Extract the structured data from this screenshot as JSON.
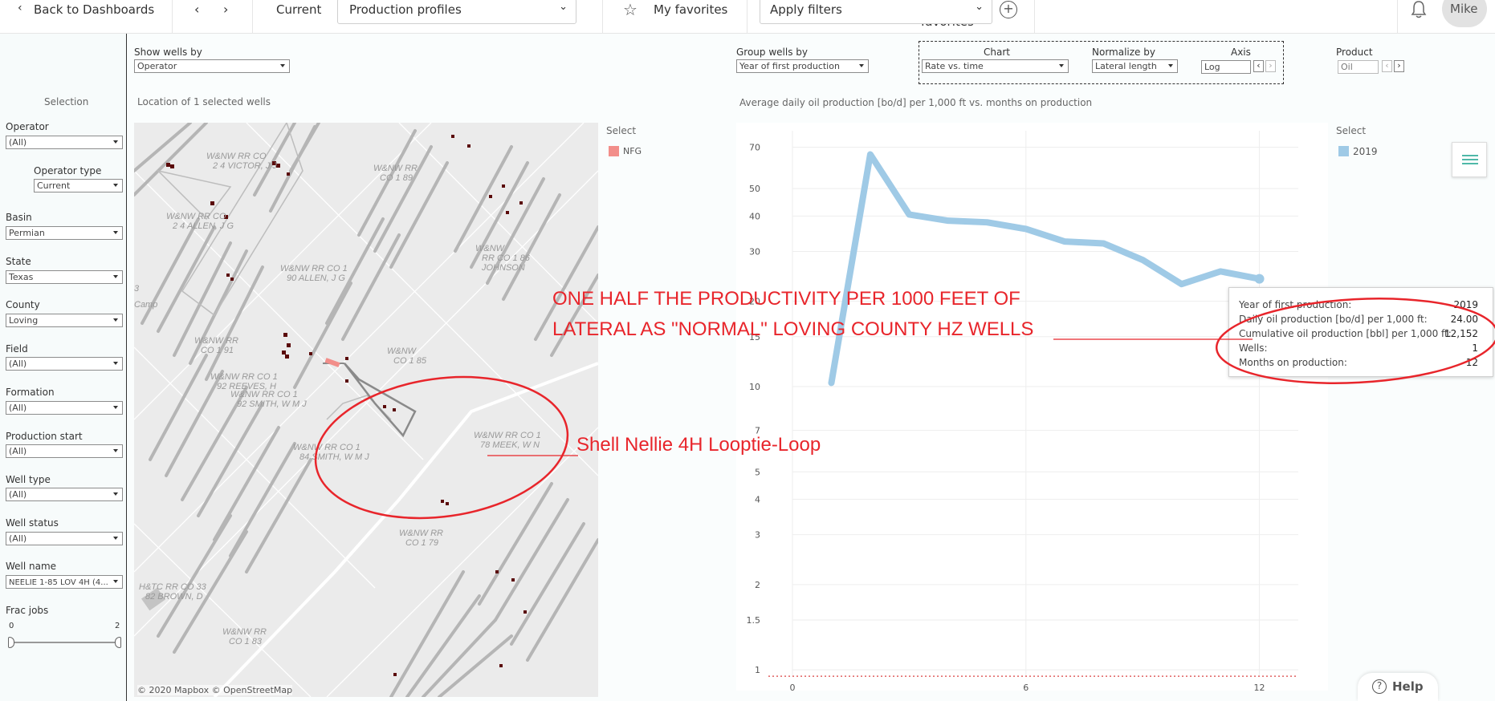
{
  "topbar": {
    "back_label": "Back to Dashboards",
    "current_label": "Current",
    "current_value": "Production profiles",
    "favorites_label": "My favorites",
    "filters_placeholder": "Apply filters",
    "user_name": "Mike"
  },
  "left_panel": {
    "title": "Selection",
    "filters": [
      {
        "label": "Operator",
        "value": "(All)"
      },
      {
        "label": "Operator type",
        "value": "Current"
      },
      {
        "label": "Basin",
        "value": "Permian"
      },
      {
        "label": "State",
        "value": "Texas"
      },
      {
        "label": "County",
        "value": "Loving"
      },
      {
        "label": "Field",
        "value": "(All)"
      },
      {
        "label": "Formation",
        "value": "(All)"
      },
      {
        "label": "Production start",
        "value": "(All)"
      },
      {
        "label": "Well type",
        "value": "(All)"
      },
      {
        "label": "Well status",
        "value": "(All)"
      },
      {
        "label": "Well name",
        "value": "NEELIE 1-85 LOV 4H (4..."
      }
    ],
    "frac_jobs": {
      "label": "Frac jobs",
      "min": "0",
      "max": "2"
    }
  },
  "controls": {
    "show_wells_by_label": "Show wells by",
    "show_wells_by_value": "Operator",
    "group_wells_by_label": "Group wells by",
    "group_wells_by_value": "Year of first production",
    "chart_label": "Chart",
    "chart_value": "Rate vs. time",
    "normalize_label": "Normalize by",
    "normalize_value": "Lateral length",
    "axis_label": "Axis",
    "axis_value": "Log",
    "product_label": "Product",
    "product_value": "Oil"
  },
  "map": {
    "caption": "Location of 1 selected wells",
    "legend_title": "Select",
    "legend_item": "NFG",
    "legend_color": "#f28e8a",
    "attribution": "© 2020 Mapbox © OpenStreetMap",
    "labels": [
      "W&NW RR CO\n2 4 VICTOR, J J",
      "W&NW RR\nCO 1 89",
      "W&NW RR CO\n2 4 ALLEN, J G",
      "W&NW\nRR CO 1 86\nJOHNSON",
      "W&NW RR CO 1\n90 ALLEN, J G",
      "W&NW RR\nCO 1 91",
      "W&NW RR CO 1\n92 REEVES, H",
      "W&NW RR CO 1\n92 SMITH, W M J",
      "W&NW\nCO 1 85",
      "W&NW RR CO 1\n84 SMITH, W M J",
      "W&NW RR CO 1\n78 MEEK, W N",
      "H&TC RR CO 33\n82 BROWN, D",
      "W&NW RR\nCO 1 79",
      "W&NW RR\nCO 1 83",
      "Camp",
      "3"
    ]
  },
  "chart": {
    "caption": "Average daily oil production [bo/d] per 1,000 ft vs. months on production",
    "legend_title": "Select",
    "legend_item": "2019",
    "series_color": "#9fcae6"
  },
  "chart_data": {
    "type": "line",
    "title": "Average daily oil production [bo/d] per 1,000 ft vs. months on production",
    "xlabel": "",
    "ylabel": "",
    "yscale": "log",
    "xlim": [
      0,
      13
    ],
    "ylim": [
      0.95,
      80
    ],
    "x_ticks": [
      0,
      6,
      12
    ],
    "y_ticks": [
      1,
      1.5,
      2,
      3,
      4,
      5,
      7,
      10,
      15,
      20,
      30,
      40,
      50,
      70
    ],
    "series": [
      {
        "name": "2019",
        "x": [
          1,
          2,
          3,
          4,
          5,
          6,
          7,
          8,
          9,
          10,
          11,
          12
        ],
        "values": [
          10.3,
          66,
          40.5,
          38.5,
          38,
          36,
          32.5,
          32,
          28,
          23,
          25.5,
          24
        ]
      }
    ]
  },
  "tooltip": {
    "rows": [
      {
        "label": "Year of first production:",
        "value": "2019"
      },
      {
        "label": "Daily oil production [bo/d] per 1,000 ft:",
        "value": "24.00"
      },
      {
        "label": "Cumulative oil production [bbl] per 1,000 ft:",
        "value": "12,152"
      },
      {
        "label": "Wells:",
        "value": "1"
      },
      {
        "label": "Months on production:",
        "value": "12"
      }
    ]
  },
  "annotations": {
    "headline_line1": "ONE HALF THE PRODUCTIVITY PER 1000 FEET OF",
    "headline_line2": "LATERAL AS \"NORMAL\" LOVING COUNTY HZ WELLS",
    "well_callout": "Shell Nellie 4H Looptie-Loop",
    "color": "#e8252b"
  },
  "help_label": "Help"
}
